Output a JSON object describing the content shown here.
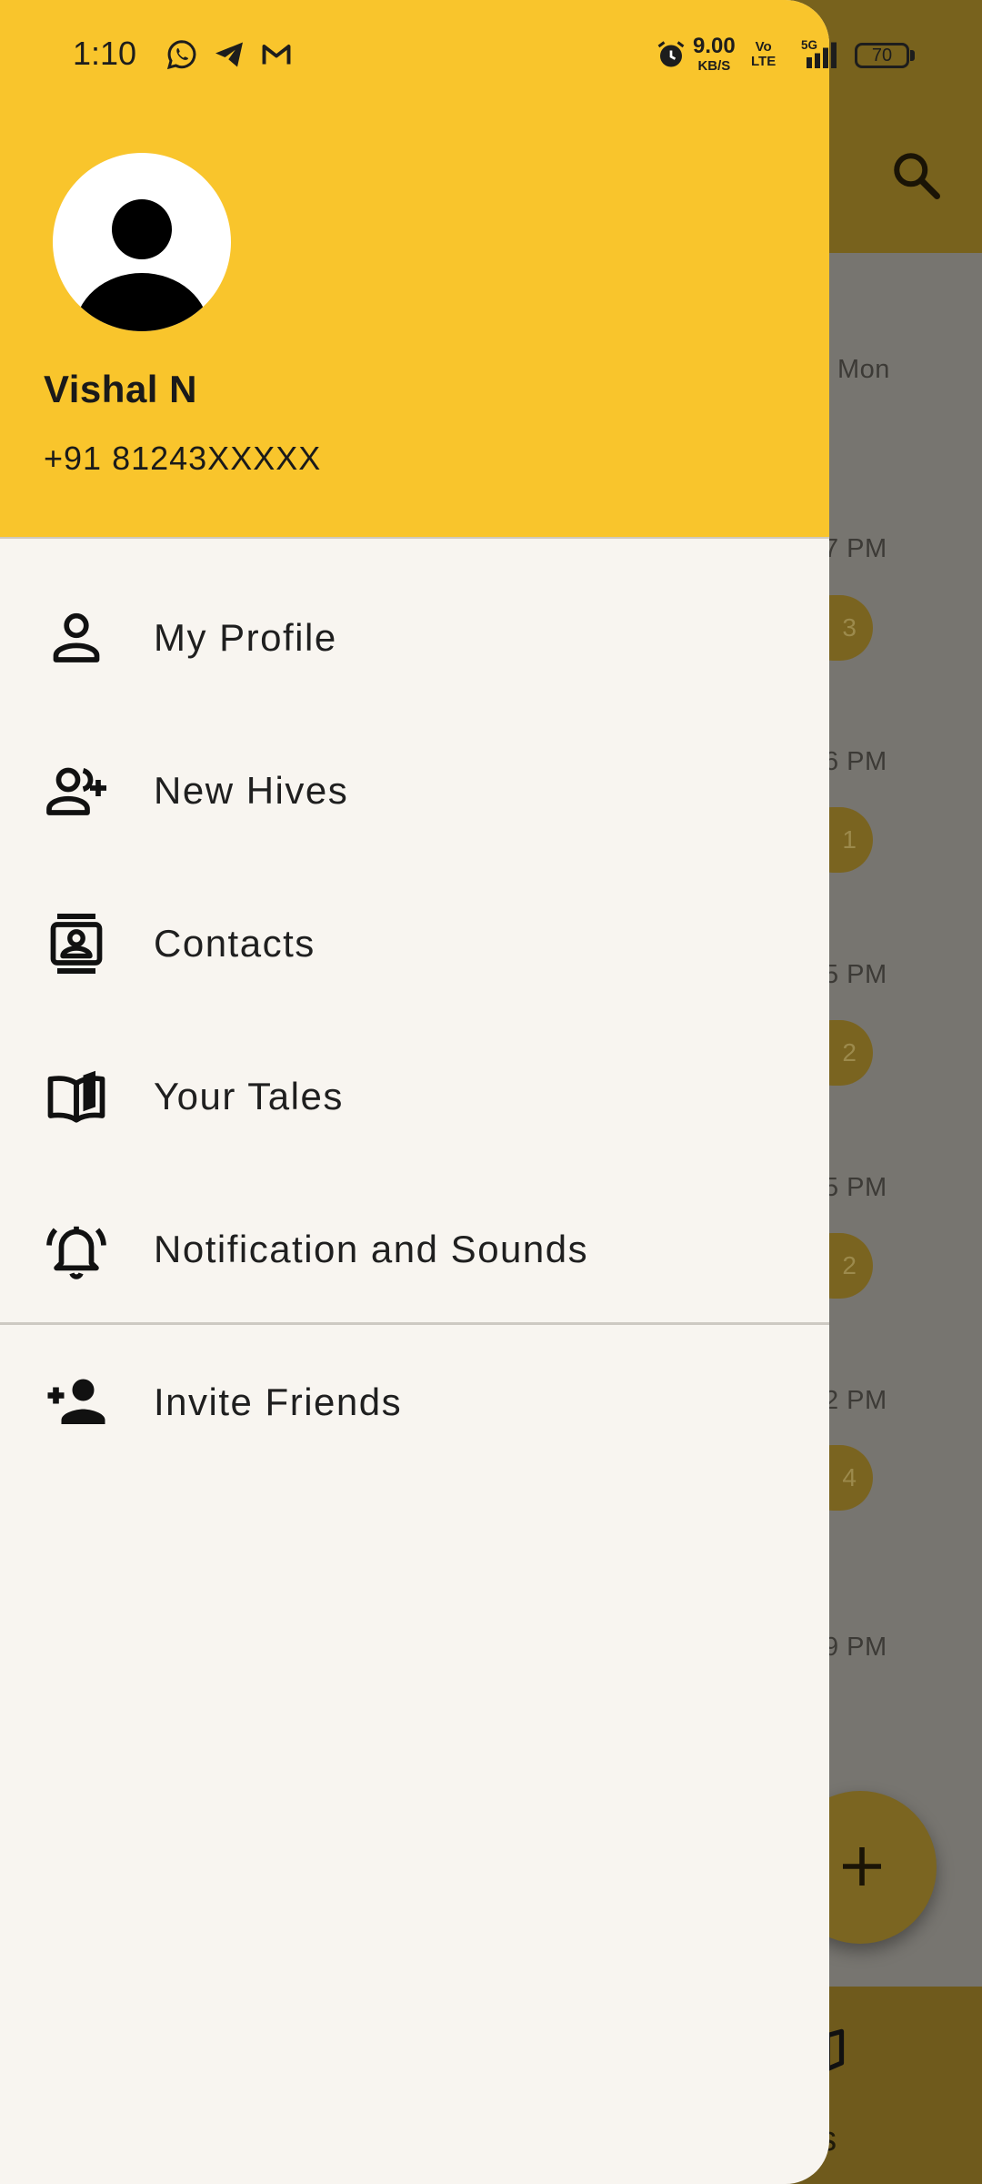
{
  "status_bar": {
    "time": "1:10",
    "speed_value": "9.00",
    "speed_unit": "KB/S",
    "volte_1": "Vo",
    "volte_2": "LTE",
    "network": "5G",
    "battery": "70",
    "icons": [
      "whatsapp-icon",
      "telegram-icon",
      "gmail-icon",
      "alarm-icon",
      "signal-icon"
    ]
  },
  "background": {
    "day_label": "Mon",
    "times": [
      "7 PM",
      "6 PM",
      "5 PM",
      "5 PM",
      "2 PM",
      "9 PM"
    ],
    "badges": [
      "3",
      "1",
      "2",
      "2",
      "4"
    ],
    "bottom_label": "es",
    "fab_icon": "plus-icon",
    "search_icon": "search-icon"
  },
  "drawer": {
    "user": {
      "name": "Vishal N",
      "phone": "+91 81243XXXXX"
    },
    "menu": [
      {
        "label": "My Profile",
        "icon": "person-icon"
      },
      {
        "label": "New Hives",
        "icon": "group-add-icon"
      },
      {
        "label": "Contacts",
        "icon": "contacts-icon"
      },
      {
        "label": "Your Tales",
        "icon": "book-icon"
      },
      {
        "label": "Notification and Sounds",
        "icon": "bell-ring-icon"
      }
    ],
    "secondary_menu": [
      {
        "label": "Invite Friends",
        "icon": "person-add-icon"
      }
    ]
  },
  "colors": {
    "header": "#f9c52c",
    "drawer_bg": "#f8f5f0",
    "scrim": "#777570"
  }
}
